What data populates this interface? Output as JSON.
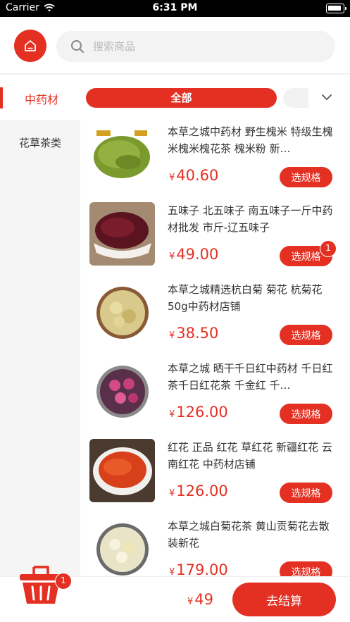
{
  "status_bar": {
    "carrier": "Carrier",
    "time": "6:31 PM"
  },
  "search": {
    "placeholder": "搜索商品",
    "value": ""
  },
  "category": {
    "label": "中药材",
    "chip_all": "全部"
  },
  "sidebar": {
    "items": [
      {
        "label": "花草茶类"
      }
    ]
  },
  "currency_symbol": "¥",
  "products": [
    {
      "title": "本草之城中药材 野生槐米 特级生槐米槐米槐花茶 槐米粉 新…",
      "price": "40.60",
      "button": "选规格",
      "badge": ""
    },
    {
      "title": "五味子 北五味子 南五味子一斤中药材批发 市斤-辽五味子",
      "price": "49.00",
      "button": "选规格",
      "badge": "1"
    },
    {
      "title": "本草之城精选杭白菊 菊花 杭菊花 50g中药材店铺",
      "price": "38.50",
      "button": "选规格",
      "badge": ""
    },
    {
      "title": "本草之城 晒干千日红中药材 千日红茶千日红花茶 千金红 千…",
      "price": "126.00",
      "button": "选规格",
      "badge": ""
    },
    {
      "title": "红花 正品 红花 草红花 新疆红花 云南红花 中药材店铺",
      "price": "126.00",
      "button": "选规格",
      "badge": ""
    },
    {
      "title": "本草之城白菊花茶 黄山贡菊花去散装新花",
      "price": "179.00",
      "button": "选规格",
      "badge": ""
    }
  ],
  "cart": {
    "badge": "1",
    "total": "49",
    "checkout_label": "去结算"
  },
  "colors": {
    "accent": "#e33022",
    "sidebar_bg": "#f5f5f5",
    "search_bg": "#f3f3f3"
  },
  "icons": [
    "wifi-icon",
    "battery-icon",
    "home-icon",
    "search-icon",
    "chevron-down-icon",
    "cart-basket-icon"
  ]
}
